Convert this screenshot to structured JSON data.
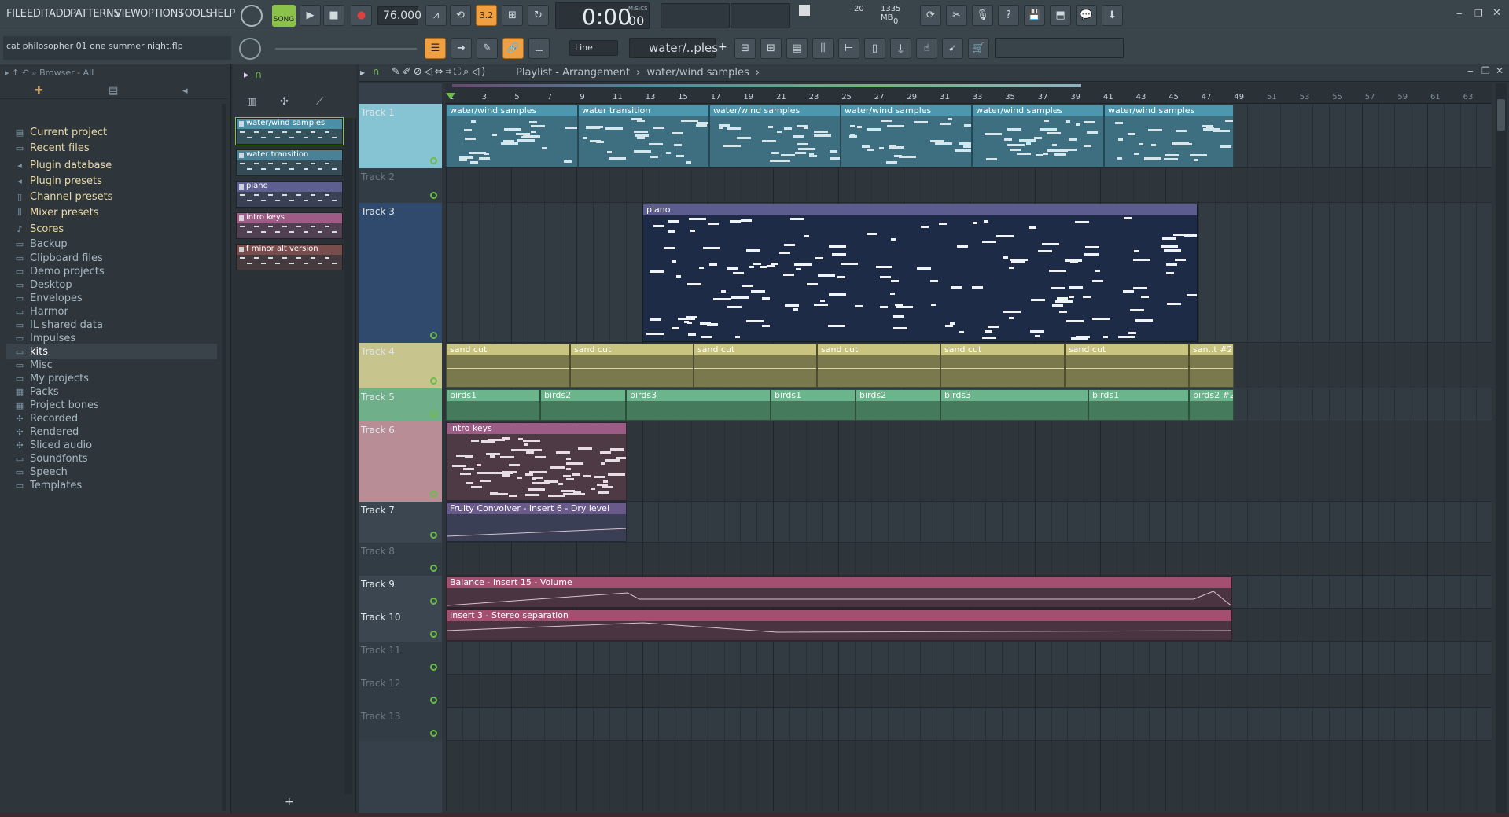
{
  "menu": [
    "FILE",
    "EDIT",
    "ADD",
    "PATTERNS",
    "VIEW",
    "OPTIONS",
    "TOOLS",
    "HELP"
  ],
  "transport": {
    "song_label": "SONG",
    "tempo": "76.000",
    "time": "0:00",
    "time_sub": "00",
    "time_unit": "M:S:CS",
    "cpu": "20",
    "memory": "1335 MB",
    "poly": "0"
  },
  "project": {
    "filename": "cat philosopher 01 one summer night.flp"
  },
  "snap": {
    "mode": "Line",
    "pattern_selector": "water/..ples",
    "pattern_add": "+"
  },
  "browser": {
    "header": "Browser - All",
    "items": [
      {
        "label": "Current project",
        "icon": "project-icon"
      },
      {
        "label": "Recent files",
        "icon": "folder-icon"
      },
      {
        "label": "Plugin database",
        "icon": "plug-icon"
      },
      {
        "label": "Plugin presets",
        "icon": "plug-icon"
      },
      {
        "label": "Channel presets",
        "icon": "channel-icon"
      },
      {
        "label": "Mixer presets",
        "icon": "mixer-icon"
      },
      {
        "label": "Scores",
        "icon": "note-icon"
      },
      {
        "label": "Backup",
        "icon": "folder-icon"
      },
      {
        "label": "Clipboard files",
        "icon": "folder-icon"
      },
      {
        "label": "Demo projects",
        "icon": "folder-icon"
      },
      {
        "label": "Desktop",
        "icon": "folder-icon"
      },
      {
        "label": "Envelopes",
        "icon": "folder-icon"
      },
      {
        "label": "Harmor",
        "icon": "folder-icon"
      },
      {
        "label": "IL shared data",
        "icon": "folder-icon"
      },
      {
        "label": "Impulses",
        "icon": "folder-icon"
      },
      {
        "label": "kits",
        "icon": "folder-icon"
      },
      {
        "label": "Misc",
        "icon": "folder-icon"
      },
      {
        "label": "My projects",
        "icon": "folder-icon"
      },
      {
        "label": "Packs",
        "icon": "pack-icon"
      },
      {
        "label": "Project bones",
        "icon": "pack-icon"
      },
      {
        "label": "Recorded",
        "icon": "mic-icon"
      },
      {
        "label": "Rendered",
        "icon": "mic-icon"
      },
      {
        "label": "Sliced audio",
        "icon": "mic-icon"
      },
      {
        "label": "Soundfonts",
        "icon": "folder-icon"
      },
      {
        "label": "Speech",
        "icon": "folder-icon"
      },
      {
        "label": "Templates",
        "icon": "folder-icon"
      }
    ]
  },
  "picker": {
    "patterns": [
      {
        "label": "water/wind samples",
        "color": "#4a8fa6"
      },
      {
        "label": "water transition",
        "color": "#4b8196"
      },
      {
        "label": "piano",
        "color": "#5c5f90"
      },
      {
        "label": "intro keys",
        "color": "#9d5c86"
      },
      {
        "label": "f minor alt version",
        "color": "#7a4d4d"
      }
    ],
    "add_label": "+"
  },
  "playlist": {
    "breadcrumb": [
      "Playlist - Arrangement",
      "water/wind samples"
    ],
    "ruler": [
      "1",
      "3",
      "5",
      "7",
      "9",
      "11",
      "13",
      "15",
      "17",
      "19",
      "21",
      "23",
      "25",
      "27",
      "29",
      "31",
      "33",
      "35",
      "37",
      "39",
      "41",
      "43",
      "45",
      "47",
      "49",
      "51",
      "53",
      "55",
      "57",
      "59",
      "61",
      "63"
    ],
    "tracks": [
      {
        "label": "Track 1",
        "color": "#86c3d3",
        "active": true
      },
      {
        "label": "Track 2",
        "color": "#323c44",
        "active": false
      },
      {
        "label": "Track 3",
        "color": "#2f4a6c",
        "active": true
      },
      {
        "label": "Track 4",
        "color": "#c7c48d",
        "active": true
      },
      {
        "label": "Track 5",
        "color": "#6fb08a",
        "active": true
      },
      {
        "label": "Track 6",
        "color": "#b98d96",
        "active": true
      },
      {
        "label": "Track 7",
        "color": "#3b4650",
        "active": true
      },
      {
        "label": "Track 8",
        "color": "#323c44",
        "active": false
      },
      {
        "label": "Track 9",
        "color": "#3b4650",
        "active": true
      },
      {
        "label": "Track 10",
        "color": "#3b4650",
        "active": true
      },
      {
        "label": "Track 11",
        "color": "#323c44",
        "active": false
      },
      {
        "label": "Track 12",
        "color": "#323c44",
        "active": false
      },
      {
        "label": "Track 13",
        "color": "#323c44",
        "active": false
      }
    ],
    "clips": {
      "track1": [
        "water/wind samples",
        "water transition",
        "water/wind samples",
        "water/wind samples",
        "water/wind samples",
        "water/wind samples"
      ],
      "track3": "piano",
      "track4": [
        "sand cut",
        "sand cut",
        "sand cut",
        "sand cut",
        "sand cut",
        "sand cut",
        "san..t #2"
      ],
      "track5": [
        "birds1",
        "birds2",
        "birds3",
        "birds1",
        "birds2",
        "birds3",
        "birds1",
        "birds2 #2"
      ],
      "track6": "intro keys",
      "track7": "Fruity Convolver - Insert 6 - Dry level",
      "track9": "Balance - Insert 15 - Volume",
      "track10": "Insert 3 - Stereo separation"
    }
  }
}
